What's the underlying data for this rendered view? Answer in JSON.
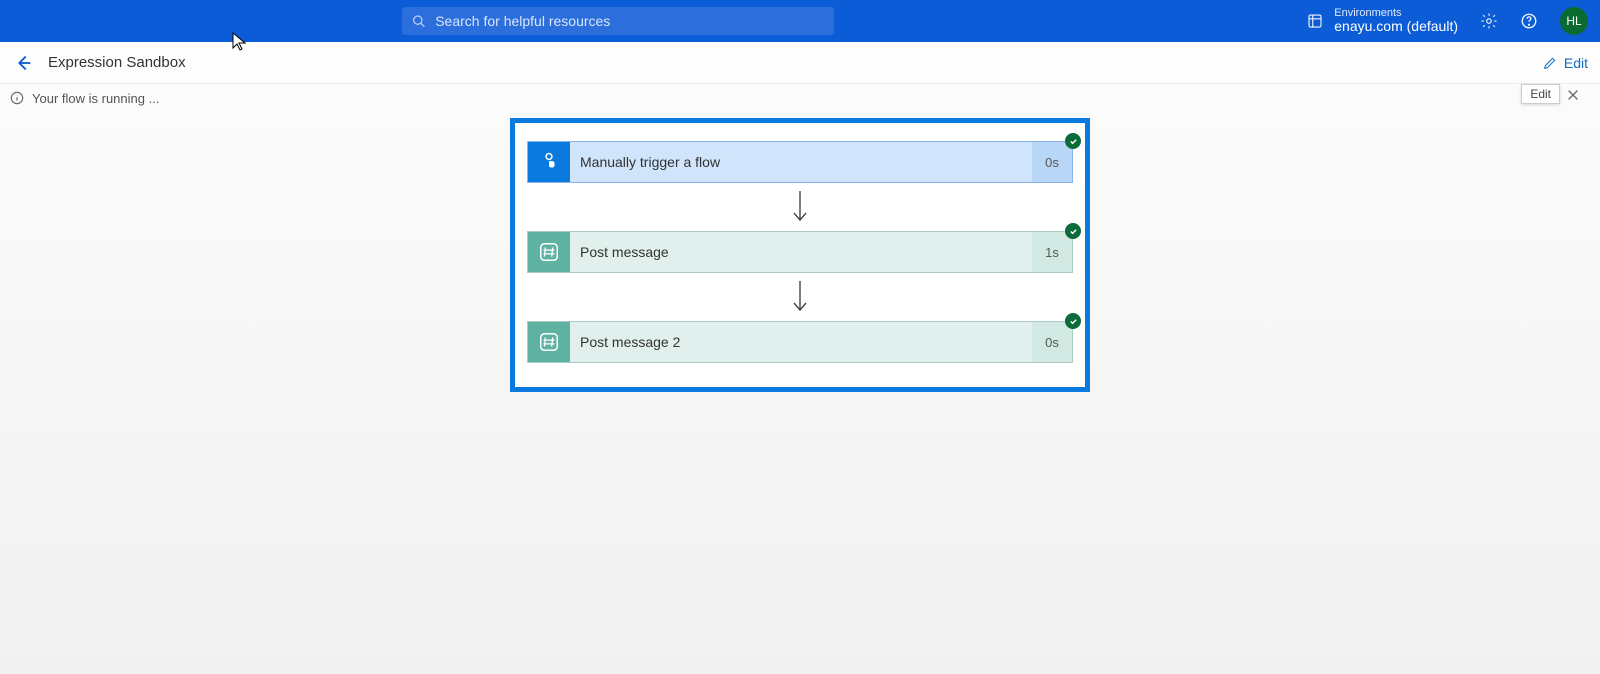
{
  "header": {
    "search_placeholder": "Search for helpful resources",
    "env_label": "Environments",
    "env_name": "enayu.com (default)",
    "avatar_initials": "HL"
  },
  "subheader": {
    "title": "Expression Sandbox",
    "edit_label": "Edit"
  },
  "status": {
    "message": "Your flow is running ...",
    "tooltip": "Edit"
  },
  "flow": {
    "steps": [
      {
        "label": "Manually trigger a flow",
        "duration": "0s",
        "type": "trigger"
      },
      {
        "label": "Post message",
        "duration": "1s",
        "type": "action"
      },
      {
        "label": "Post message 2",
        "duration": "0s",
        "type": "action"
      }
    ]
  }
}
